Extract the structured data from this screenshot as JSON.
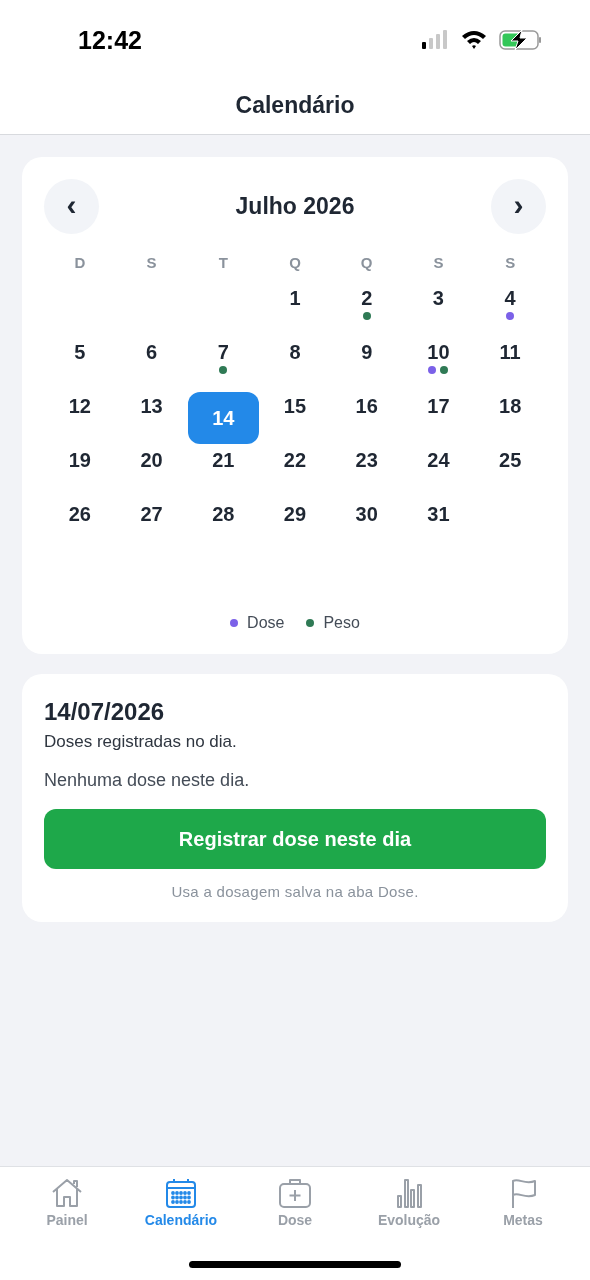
{
  "status_bar": {
    "time": "12:42"
  },
  "header": {
    "title": "Calendário"
  },
  "calendar": {
    "month": "Julho 2026",
    "prev": "‹",
    "next": "›",
    "weekdays": [
      "D",
      "S",
      "T",
      "Q",
      "Q",
      "S",
      "S"
    ],
    "weeks": [
      [
        {
          "kind": "blank"
        },
        {
          "kind": "blank"
        },
        {
          "kind": "blank"
        },
        {
          "kind": "day",
          "day": "1",
          "selected": false
        },
        {
          "kind": "day",
          "day": "2",
          "selected": false,
          "markers": [
            {
              "color": "#2f7a55"
            }
          ]
        },
        {
          "kind": "day",
          "day": "3",
          "selected": false
        },
        {
          "kind": "day",
          "day": "4",
          "selected": false,
          "markers": [
            {
              "color": "#7b61e8"
            }
          ]
        }
      ],
      [
        {
          "kind": "day",
          "day": "5",
          "selected": false
        },
        {
          "kind": "day",
          "day": "6",
          "selected": false
        },
        {
          "kind": "day",
          "day": "7",
          "selected": false,
          "markers": [
            {
              "color": "#2f7a55"
            }
          ]
        },
        {
          "kind": "day",
          "day": "8",
          "selected": false
        },
        {
          "kind": "day",
          "day": "9",
          "selected": false
        },
        {
          "kind": "day",
          "day": "10",
          "selected": false,
          "markers": [
            {
              "color": "#7b61e8"
            },
            {
              "color": "#2f7a55"
            }
          ]
        },
        {
          "kind": "day",
          "day": "11",
          "selected": false
        }
      ],
      [
        {
          "kind": "day",
          "day": "12",
          "selected": false
        },
        {
          "kind": "day",
          "day": "13",
          "selected": false
        },
        {
          "kind": "day",
          "day": "14",
          "selected": true
        },
        {
          "kind": "day",
          "day": "15",
          "selected": false
        },
        {
          "kind": "day",
          "day": "16",
          "selected": false
        },
        {
          "kind": "day",
          "day": "17",
          "selected": false
        },
        {
          "kind": "day",
          "day": "18",
          "selected": false
        }
      ],
      [
        {
          "kind": "day",
          "day": "19",
          "selected": false
        },
        {
          "kind": "day",
          "day": "20",
          "selected": false
        },
        {
          "kind": "day",
          "day": "21",
          "selected": false
        },
        {
          "kind": "day",
          "day": "22",
          "selected": false
        },
        {
          "kind": "day",
          "day": "23",
          "selected": false
        },
        {
          "kind": "day",
          "day": "24",
          "selected": false
        },
        {
          "kind": "day",
          "day": "25",
          "selected": false
        }
      ],
      [
        {
          "kind": "day",
          "day": "26",
          "selected": false
        },
        {
          "kind": "day",
          "day": "27",
          "selected": false
        },
        {
          "kind": "day",
          "day": "28",
          "selected": false
        },
        {
          "kind": "day",
          "day": "29",
          "selected": false
        },
        {
          "kind": "day",
          "day": "30",
          "selected": false
        },
        {
          "kind": "day",
          "day": "31",
          "selected": false
        },
        {
          "kind": "blank"
        }
      ]
    ],
    "legend": [
      {
        "label": "Dose",
        "color": "#7b61e8"
      },
      {
        "label": "Peso",
        "color": "#2f7a55"
      }
    ]
  },
  "day_panel": {
    "date": "14/07/2026",
    "subtitle": "Doses registradas no dia.",
    "empty_message": "Nenhuma dose neste dia.",
    "button": "Registrar dose neste dia",
    "hint": "Usa a dosagem salva na aba Dose."
  },
  "tab_bar": [
    {
      "kind": "home",
      "label": "Painel",
      "selected": false
    },
    {
      "kind": "calendar",
      "label": "Calendário",
      "selected": true
    },
    {
      "kind": "medkit",
      "label": "Dose",
      "selected": false
    },
    {
      "kind": "chart",
      "label": "Evolução",
      "selected": false
    },
    {
      "kind": "flag",
      "label": "Metas",
      "selected": false
    }
  ]
}
